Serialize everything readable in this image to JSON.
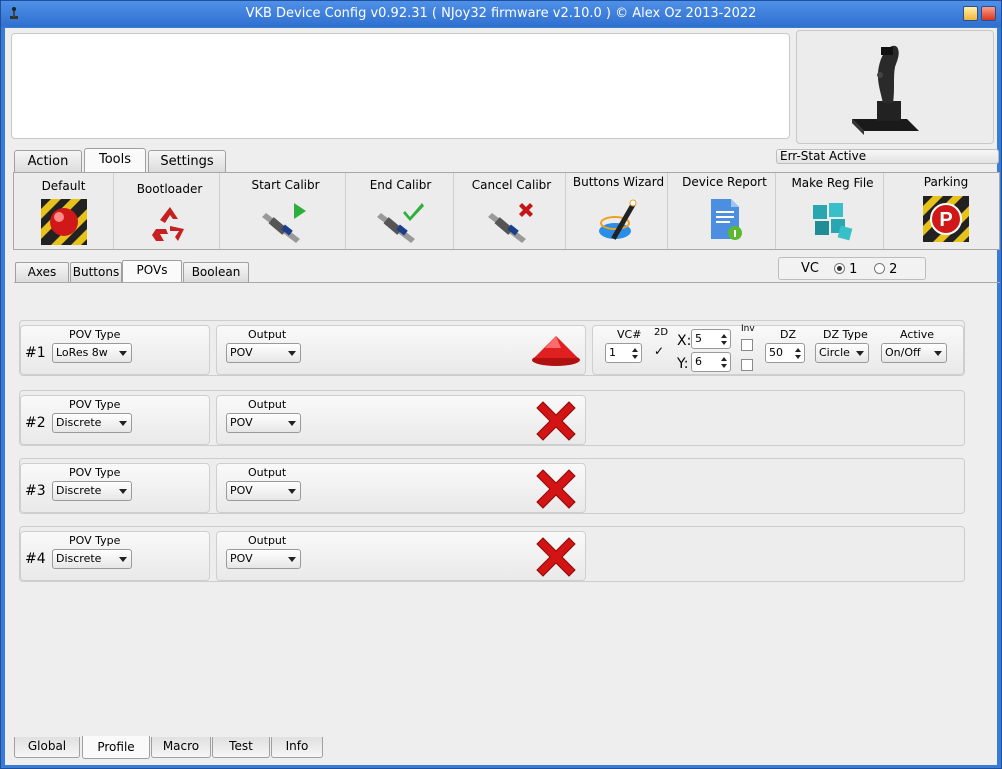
{
  "window": {
    "title": "VKB Device Config v0.92.31 ( NJoy32 firmware v2.10.0 ) © Alex Oz 2013-2022"
  },
  "status": "Err-Stat Active",
  "main_tabs": [
    {
      "label": "Action",
      "active": false
    },
    {
      "label": "Tools",
      "active": true
    },
    {
      "label": "Settings",
      "active": false
    }
  ],
  "tools": [
    {
      "label": "Default",
      "icon": "red-ball-icon"
    },
    {
      "label": "Bootloader",
      "icon": "recycle-icon"
    },
    {
      "label": "Start Calibr",
      "icon": "caliper-play-icon"
    },
    {
      "label": "End Calibr",
      "icon": "caliper-check-icon"
    },
    {
      "label": "Cancel Calibr",
      "icon": "caliper-cancel-icon"
    },
    {
      "label": "Buttons Wizard",
      "icon": "wizard-wand-icon"
    },
    {
      "label": "Device Report",
      "icon": "report-doc-icon"
    },
    {
      "label": "Make Reg File",
      "icon": "registry-cubes-icon"
    },
    {
      "label": "Parking",
      "icon": "parking-icon"
    }
  ],
  "sub_tabs": [
    {
      "label": "Axes",
      "active": false
    },
    {
      "label": "Buttons",
      "active": false
    },
    {
      "label": "POVs",
      "active": true
    },
    {
      "label": "Boolean",
      "active": false
    }
  ],
  "vc": {
    "label": "VC",
    "options": [
      "1",
      "2"
    ],
    "selected": "1"
  },
  "pov_labels": {
    "pov_type": "POV Type",
    "output": "Output"
  },
  "povs": [
    {
      "num": "#1",
      "type": "LoRes 8w",
      "output": "POV",
      "status_icon": "pov-hat-icon"
    },
    {
      "num": "#2",
      "type": "Discrete",
      "output": "POV",
      "status_icon": "red-x-icon"
    },
    {
      "num": "#3",
      "type": "Discrete",
      "output": "POV",
      "status_icon": "red-x-icon"
    },
    {
      "num": "#4",
      "type": "Discrete",
      "output": "POV",
      "status_icon": "red-x-icon"
    }
  ],
  "pov1_extra": {
    "vc_label": "VC#",
    "vc_value": "1",
    "twod_label": "2D",
    "twod_checked": true,
    "x_label": "X:",
    "x_value": "5",
    "y_label": "Y:",
    "y_value": "6",
    "inv_label": "Inv",
    "dz_label": "DZ",
    "dz_value": "50",
    "dztype_label": "DZ Type",
    "dztype_value": "Circle",
    "active_label": "Active",
    "active_value": "On/Off"
  },
  "bottom_tabs": [
    {
      "label": "Global",
      "active": false
    },
    {
      "label": "Profile",
      "active": true
    },
    {
      "label": "Macro",
      "active": false
    },
    {
      "label": "Test",
      "active": false
    },
    {
      "label": "Info",
      "active": false
    }
  ],
  "colors": {
    "titlebar": "#3a7bd5",
    "accent_red": "#d01818"
  }
}
